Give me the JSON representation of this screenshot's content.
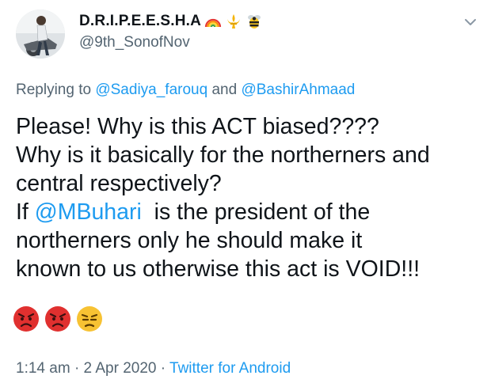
{
  "tweet": {
    "author": {
      "display_name": "D.R.I.P.E.E.S.H.A",
      "handle": "@9th_SonofNov",
      "avatar_icon": "profile-photo",
      "name_emoji": [
        "rainbow-icon",
        "fleur-icon",
        "bee-icon"
      ]
    },
    "reply": {
      "prefix": "Replying to",
      "user1": "@Sadiya_farouq",
      "conj": "and",
      "user2": "@BashirAhmaad"
    },
    "body": {
      "line1": "Please! Why is this ACT biased????",
      "line2": "Why is it basically for the northerners and",
      "line3": "central respectively?",
      "line4_pre": "If",
      "line4_mention": "@MBuhari",
      "line4_post": "is the president of the",
      "line5": "northerners only he should make it",
      "line6": "known to us otherwise this act is VOID!!!",
      "emoji": [
        "angry-face-icon",
        "angry-face-icon",
        "annoyed-face-icon"
      ]
    },
    "meta": {
      "time": "1:14 am",
      "sep1": "·",
      "date": "2 Apr 2020",
      "sep2": "·",
      "source": "Twitter for Android"
    },
    "colors": {
      "link": "#1d9bf0",
      "muted": "#536471",
      "text": "#0f1419",
      "angry": "#e0302f",
      "annoyed": "#f7c233"
    }
  }
}
